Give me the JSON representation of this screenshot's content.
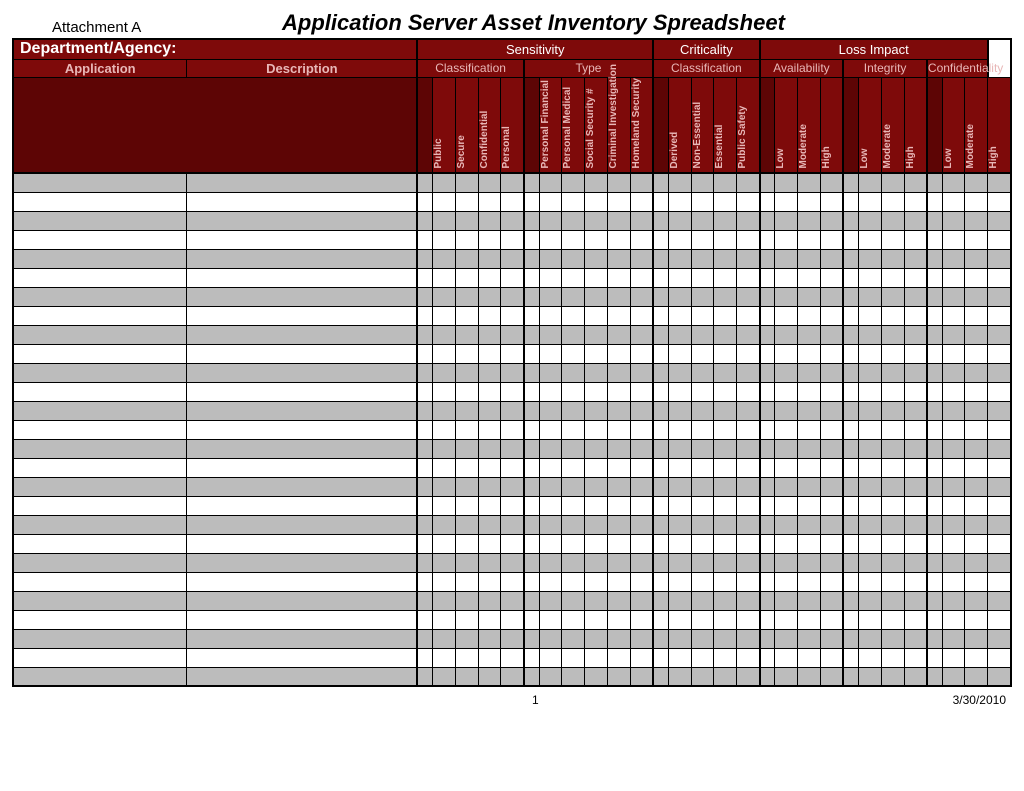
{
  "top": {
    "attachment": "Attachment A",
    "title": "Application Server Asset Inventory Spreadsheet"
  },
  "header": {
    "department_agency_label": "Department/Agency:",
    "application_label": "Application",
    "description_label": "Description",
    "groups": {
      "sensitivity": "Sensitivity",
      "criticality": "Criticality",
      "loss_impact": "Loss Impact"
    },
    "subgroups": {
      "classification_s": "Classification",
      "type": "Type",
      "classification_c": "Classification",
      "availability": "Availability",
      "integrity": "Integrity",
      "confidentiality": "Confidentiality"
    },
    "cols_classification_s": [
      "Public",
      "Secure",
      "Confidential",
      "Personal"
    ],
    "cols_type": [
      "Personal Financial",
      "Personal Medical",
      "Social Security #",
      "Criminal Investigation",
      "Homeland Security"
    ],
    "cols_classification_c": [
      "Derived",
      "Non-Essential",
      "Essential",
      "Public Safety"
    ],
    "cols_availability": [
      "Low",
      "Moderate",
      "High"
    ],
    "cols_integrity": [
      "Low",
      "Moderate",
      "High"
    ],
    "cols_confidentiality": [
      "Low",
      "Moderate",
      "High"
    ]
  },
  "rows_count": 27,
  "footer": {
    "page": "1",
    "date": "3/30/2010"
  }
}
